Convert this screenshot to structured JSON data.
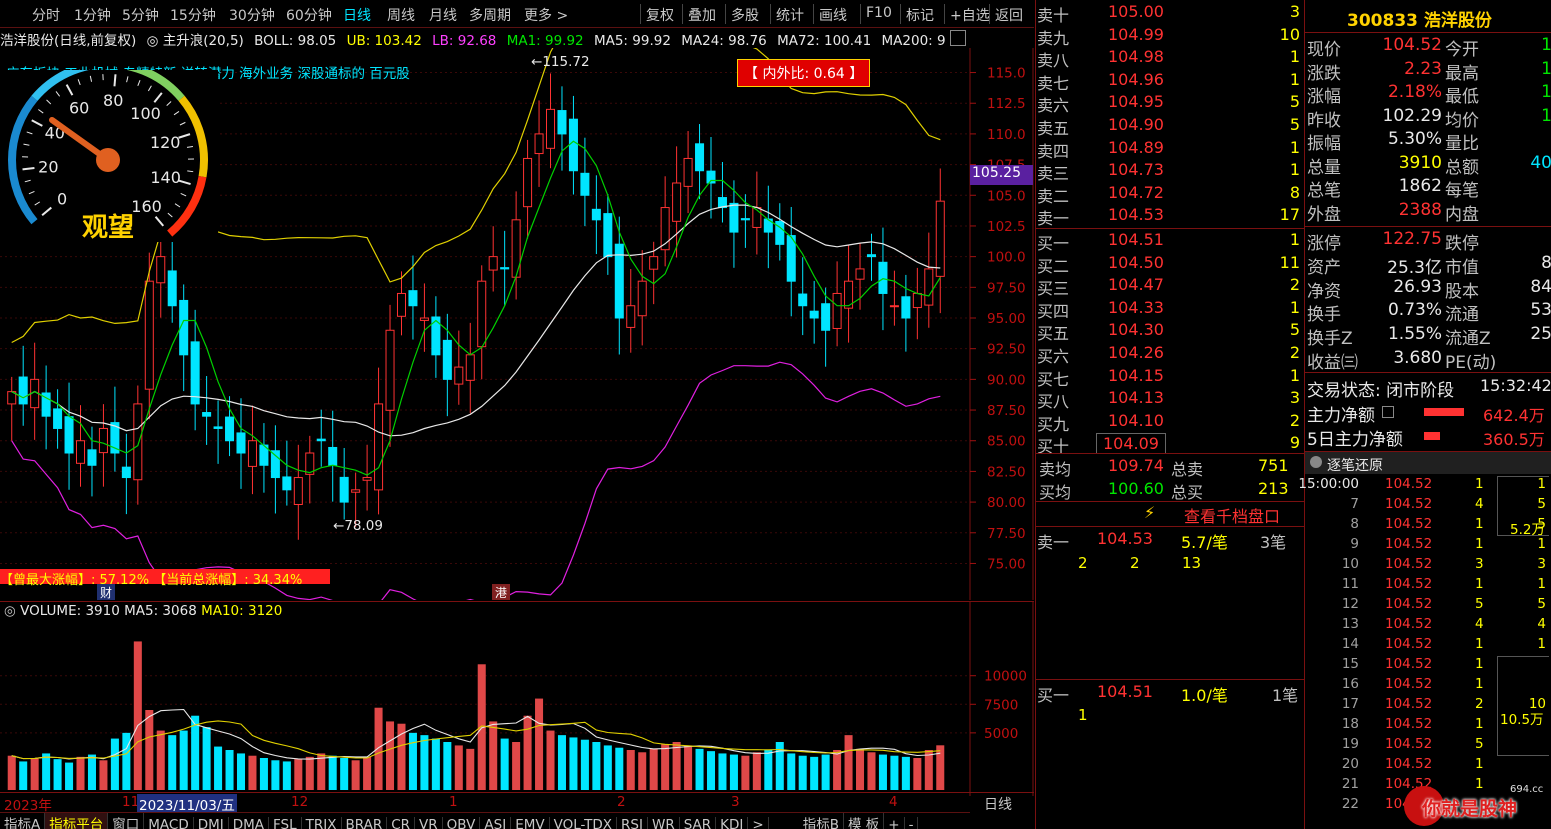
{
  "toolbar": {
    "periods": [
      "分时",
      "1分钟",
      "5分钟",
      "15分钟",
      "30分钟",
      "60分钟",
      "日线",
      "周线",
      "月线",
      "多周期",
      "更多 >"
    ],
    "active_period": "日线",
    "tools": [
      "复权",
      "叠加",
      "多股",
      "统计",
      "画线",
      "F10",
      "标记",
      "+自选",
      "返回"
    ]
  },
  "indicator_line": {
    "stock": "浩洋股份(日线,前复权)",
    "main": "主升浪(20,5)",
    "boll": "BOLL: 98.05",
    "ub": "UB: 103.42",
    "lb": "LB: 92.68",
    "ma1": "MA1: 99.92",
    "ma5": "MA5: 99.92",
    "ma24": "MA24: 98.76",
    "ma72": "MA72: 100.41",
    "ma200": "MA200: 9"
  },
  "concept_tags": "广东板块 工业机械 专精特新 送转潜力 海外业务 深股通标的 百元股",
  "gauge": {
    "status": "观望",
    "ticks": [
      "0",
      "20",
      "40",
      "60",
      "80",
      "100",
      "120",
      "140",
      "160"
    ]
  },
  "inner_outer_ratio": "【 内外比: 0.64 】",
  "annotations": {
    "high": "115.72",
    "low": "78.09",
    "max_rise": "【曾最大涨幅】: 57.12%",
    "cur_rise": "【当前总涨幅】: 34.34%",
    "cai": "财",
    "gang": "港"
  },
  "price_axis": [
    "115.0",
    "112.5",
    "110.0",
    "107.5",
    "105.0",
    "102.5",
    "100.0",
    "97.50",
    "95.00",
    "92.50",
    "90.00",
    "87.50",
    "85.00",
    "82.50",
    "80.00",
    "77.50",
    "75.00"
  ],
  "current_price_tag": "105.25",
  "volume_line": {
    "volume": "VOLUME: 3910",
    "ma5": "MA5: 3068",
    "ma10": "MA10: 3120"
  },
  "volume_axis": [
    "10000",
    "7500",
    "5000"
  ],
  "date_axis": [
    "2023年",
    "11",
    "2023/11/03/五",
    "12",
    "1",
    "2",
    "3",
    "4"
  ],
  "date_axis_right": "日线",
  "bottom_tabs": [
    "指标A",
    "指标平台",
    "窗口",
    "MACD",
    "DMI",
    "DMA",
    "FSL",
    "TRIX",
    "BRAR",
    "CR",
    "VR",
    "OBV",
    "ASI",
    "EMV",
    "VOL-TDX",
    "RSI",
    "WR",
    "SAR",
    "KDJ",
    ">",
    "指标B",
    "模 板",
    "+",
    "-"
  ],
  "chart_data": {
    "type": "candlestick",
    "title": "",
    "ylim": [
      73,
      117
    ],
    "price_high": 115.72,
    "price_low": 78.09,
    "candles_close_approx": [
      89,
      88,
      90,
      87,
      86,
      84,
      85,
      83,
      86,
      84,
      82,
      88,
      98,
      100,
      96,
      92,
      88,
      87,
      86,
      85,
      84,
      85,
      83,
      82,
      81,
      82,
      84,
      85,
      83,
      80,
      81,
      82,
      88,
      94,
      97,
      96,
      95,
      92,
      90,
      91,
      92,
      98,
      100,
      99,
      103,
      108,
      110,
      112,
      110,
      107,
      105,
      103,
      100,
      95,
      96,
      98,
      100,
      104,
      106,
      108,
      107,
      106,
      104,
      102,
      103,
      104,
      102,
      101,
      98,
      96,
      95,
      94,
      97,
      98,
      99,
      100,
      97,
      96,
      95,
      97,
      99,
      104.52
    ],
    "volume_ylim": [
      0,
      14000
    ],
    "volume_values": [
      3000,
      2500,
      2800,
      3200,
      2700,
      2400,
      2900,
      3100,
      2600,
      4500,
      5000,
      13000,
      7000,
      5200,
      4800,
      5200,
      6500,
      5500,
      3800,
      3500,
      3200,
      3000,
      2800,
      2600,
      2500,
      2700,
      2900,
      3200,
      3000,
      2800,
      2600,
      2900,
      7200,
      6000,
      5800,
      5000,
      4800,
      4500,
      4200,
      3900,
      3600,
      11000,
      6000,
      4500,
      4200,
      6500,
      8000,
      5200,
      4800,
      4600,
      4400,
      4200,
      3900,
      3700,
      3500,
      3300,
      3600,
      4000,
      4200,
      3900,
      3600,
      3400,
      3200,
      3100,
      3000,
      3300,
      3500,
      4200,
      3200,
      3000,
      2900,
      3100,
      3500,
      4800,
      3600,
      3300,
      3100,
      3000,
      2900,
      2800,
      3500,
      3910
    ]
  },
  "orderbook": {
    "asks": [
      {
        "label": "卖十",
        "price": "105.00",
        "vol": "3"
      },
      {
        "label": "卖九",
        "price": "104.99",
        "vol": "10"
      },
      {
        "label": "卖八",
        "price": "104.98",
        "vol": "1"
      },
      {
        "label": "卖七",
        "price": "104.96",
        "vol": "1"
      },
      {
        "label": "卖六",
        "price": "104.95",
        "vol": "5"
      },
      {
        "label": "卖五",
        "price": "104.90",
        "vol": "5"
      },
      {
        "label": "卖四",
        "price": "104.89",
        "vol": "1"
      },
      {
        "label": "卖三",
        "price": "104.73",
        "vol": "1"
      },
      {
        "label": "卖二",
        "price": "104.72",
        "vol": "8"
      },
      {
        "label": "卖一",
        "price": "104.53",
        "vol": "17"
      }
    ],
    "bids": [
      {
        "label": "买一",
        "price": "104.51",
        "vol": "1"
      },
      {
        "label": "买二",
        "price": "104.50",
        "vol": "11"
      },
      {
        "label": "买三",
        "price": "104.47",
        "vol": "2"
      },
      {
        "label": "买四",
        "price": "104.33",
        "vol": "1"
      },
      {
        "label": "买五",
        "price": "104.30",
        "vol": "5"
      },
      {
        "label": "买六",
        "price": "104.26",
        "vol": "2"
      },
      {
        "label": "买七",
        "price": "104.15",
        "vol": "1"
      },
      {
        "label": "买八",
        "price": "104.13",
        "vol": "3"
      },
      {
        "label": "买九",
        "price": "104.10",
        "vol": "2"
      },
      {
        "label": "买十",
        "price": "104.09",
        "vol": "9"
      }
    ],
    "avg_sell_label": "卖均",
    "avg_sell": "109.74",
    "total_sell_label": "总卖",
    "total_sell": "751",
    "avg_buy_label": "买均",
    "avg_buy": "100.60",
    "total_buy_label": "总买",
    "total_buy": "213",
    "depth_link": "查看千档盘口",
    "sell1_label": "卖一",
    "sell1_price": "104.53",
    "sell1_per": "5.7/笔",
    "sell1_cnt": "3笔",
    "sell1_queue": [
      "2",
      "2",
      "13"
    ],
    "buy1_label": "买一",
    "buy1_price": "104.51",
    "buy1_per": "1.0/笔",
    "buy1_cnt": "1笔",
    "buy1_queue": [
      "1"
    ]
  },
  "info": {
    "code_name": "300833 浩洋股份",
    "rows": [
      {
        "l1": "现价",
        "v1": "104.52",
        "c1": "red",
        "l2": "今开",
        "v2": "1"
      },
      {
        "l1": "涨跌",
        "v1": "2.23",
        "c1": "red",
        "l2": "最高",
        "v2": "1"
      },
      {
        "l1": "涨幅",
        "v1": "2.18%",
        "c1": "red",
        "l2": "最低",
        "v2": "1"
      },
      {
        "l1": "昨收",
        "v1": "102.29",
        "c1": "white",
        "l2": "均价",
        "v2": "1"
      },
      {
        "l1": "振幅",
        "v1": "5.30%",
        "c1": "white",
        "l2": "量比",
        "v2": ""
      },
      {
        "l1": "总量",
        "v1": "3910",
        "c1": "yellow",
        "l2": "总额",
        "v2": "40"
      },
      {
        "l1": "总笔",
        "v1": "1862",
        "c1": "white",
        "l2": "每笔",
        "v2": ""
      },
      {
        "l1": "外盘",
        "v1": "2388",
        "c1": "red",
        "l2": "内盘",
        "v2": ""
      },
      {
        "l1": "涨停",
        "v1": "122.75",
        "c1": "red",
        "l2": "跌停",
        "v2": ""
      },
      {
        "l1": "资产",
        "v1": "25.3亿",
        "c1": "white",
        "l2": "市值",
        "v2": "8"
      },
      {
        "l1": "净资",
        "v1": "26.93",
        "c1": "white",
        "l2": "股本",
        "v2": "84"
      },
      {
        "l1": "换手",
        "v1": "0.73%",
        "c1": "white",
        "l2": "流通",
        "v2": "53"
      },
      {
        "l1": "换手Z",
        "v1": "1.55%",
        "c1": "white",
        "l2": "流通Z",
        "v2": "25"
      },
      {
        "l1": "收益㈢",
        "v1": "3.680",
        "c1": "white",
        "l2": "PE(动)",
        "v2": ""
      }
    ],
    "trade_status_label": "交易状态: 闭市阶段",
    "trade_time": "15:32:42",
    "main_net_label": "主力净额",
    "main_net": "642.4万",
    "main5_net_label": "5日主力净额",
    "main5_net": "360.5万",
    "tick_title": "逐笔还原",
    "ticks": [
      {
        "t": "15:00:00",
        "p": "104.52",
        "v": "1",
        "x": "1"
      },
      {
        "t": "7",
        "p": "104.52",
        "v": "4",
        "x": "5"
      },
      {
        "t": "8",
        "p": "104.52",
        "v": "1",
        "x": "5"
      },
      {
        "t": "9",
        "p": "104.52",
        "v": "1",
        "x": "1"
      },
      {
        "t": "10",
        "p": "104.52",
        "v": "3",
        "x": "3"
      },
      {
        "t": "11",
        "p": "104.52",
        "v": "1",
        "x": "1"
      },
      {
        "t": "12",
        "p": "104.52",
        "v": "5",
        "x": "5"
      },
      {
        "t": "13",
        "p": "104.52",
        "v": "4",
        "x": "4"
      },
      {
        "t": "14",
        "p": "104.52",
        "v": "1",
        "x": "1"
      },
      {
        "t": "15",
        "p": "104.52",
        "v": "1",
        "x": ""
      },
      {
        "t": "16",
        "p": "104.52",
        "v": "1",
        "x": ""
      },
      {
        "t": "17",
        "p": "104.52",
        "v": "2",
        "x": "10"
      },
      {
        "t": "18",
        "p": "104.52",
        "v": "1",
        "x": ""
      },
      {
        "t": "19",
        "p": "104.52",
        "v": "5",
        "x": ""
      },
      {
        "t": "20",
        "p": "104.52",
        "v": "1",
        "x": ""
      },
      {
        "t": "21",
        "p": "104.52",
        "v": "1",
        "x": ""
      },
      {
        "t": "22",
        "p": "104.52",
        "v": "",
        "x": ""
      }
    ],
    "tick_group1": "5.2万",
    "tick_group2": "10.5万"
  },
  "watermark": "你就是股神",
  "watermark_site": "694.cc"
}
